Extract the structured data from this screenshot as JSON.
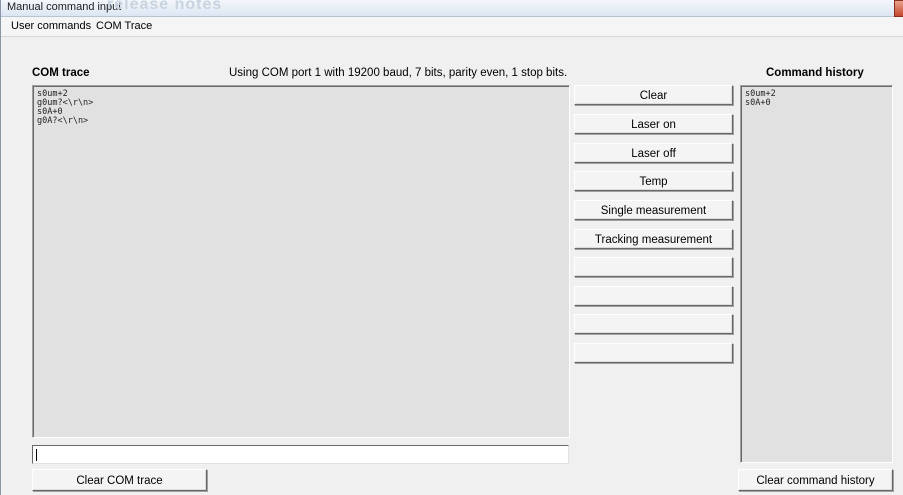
{
  "window": {
    "title": "Manual command input",
    "background_title": "release notes"
  },
  "menu": {
    "items": [
      "User commands",
      "COM Trace"
    ]
  },
  "com_trace": {
    "heading": "COM trace",
    "port_info": "Using COM port 1 with 19200 baud, 7 bits, parity even, 1 stop bits.",
    "lines": [
      "s0um+2",
      "g0um?<\\r\\n>",
      "s0A+0",
      "g0A?<\\r\\n>"
    ],
    "input_value": "",
    "clear_label": "Clear COM trace"
  },
  "commands": {
    "buttons": [
      "Clear",
      "Laser on",
      "Laser off",
      "Temp",
      "Single measurement",
      "Tracking measurement",
      "",
      "",
      "",
      ""
    ]
  },
  "history": {
    "heading": "Command history",
    "lines": [
      "s0um+2",
      "s0A+0"
    ],
    "clear_label": "Clear command history"
  }
}
